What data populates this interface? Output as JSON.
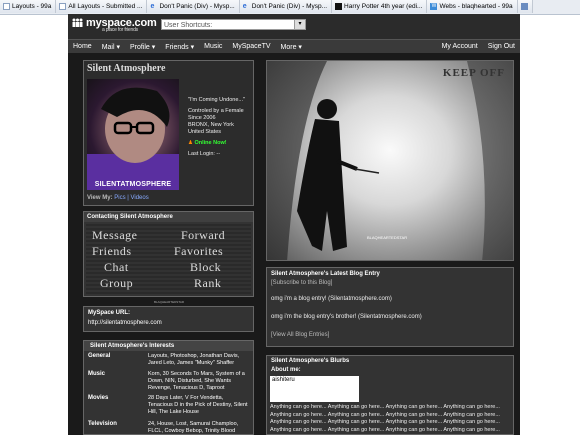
{
  "browser_tabs": [
    {
      "label": "Layouts - 99a",
      "icon": "page-icon"
    },
    {
      "label": "All Layouts - Submitted ...",
      "icon": "page-icon"
    },
    {
      "label": "Don't Panic (Div) - Mysp...",
      "icon": "ie-icon"
    },
    {
      "label": "Don't Panic (Div) - Mysp...",
      "icon": "ie-icon"
    },
    {
      "label": "Harry Potter 4th year (edi...",
      "icon": "hp-icon"
    },
    {
      "label": "Webs - blaqhearted - 99a",
      "icon": "webs-icon"
    }
  ],
  "header": {
    "logo": "myspace.com",
    "tagline": "a place for friends",
    "shortcuts_label": "User Shortcuts:"
  },
  "nav": {
    "left": [
      "Home",
      "Mail ▾",
      "Profile ▾",
      "Friends ▾",
      "Music",
      "MySpaceTV",
      "More ▾"
    ],
    "right": [
      "My Account",
      "Sign Out"
    ]
  },
  "profile": {
    "name": "Silent Atmosphere",
    "photo_caption": "SILENTATMOSPHERE",
    "quote": "\"I'm Coming Undone...\"",
    "controlled": "Controled by a Female",
    "since": "Since 2006",
    "location_city": "BRONX, New York",
    "location_country": "United States",
    "online": "Online Now!",
    "last_login": "Last Login: --",
    "view_my_prefix": "View My:",
    "view_my_links": "Pics | Videos"
  },
  "contacting": {
    "title": "Contacting Silent Atmosphere",
    "buttons": [
      "Message",
      "Forward",
      "Friends",
      "Favorites",
      "Chat",
      "Block",
      "Group",
      "Rank"
    ],
    "signature": "BLAQHEARTEDSTAR"
  },
  "myspace_url": {
    "label": "MySpace URL:",
    "value": "http://silentatmosphere.com"
  },
  "interests": {
    "title": "Silent Atmosphere's Interests",
    "rows": [
      {
        "key": "General",
        "value": "Layouts, Photoshop, Jonathan Davis, Jared Leto, James \"Munky\" Shaffer"
      },
      {
        "key": "Music",
        "value": "Korn, 30 Seconds To Mars, System of a Down, NIN, Disturbed, She Wants Revenge, Tenacious D, Taproot"
      },
      {
        "key": "Movies",
        "value": "28 Days Later, V For Vendetta, Tenacious D in the Pick of Destiny, Silent Hill, The Lake House"
      },
      {
        "key": "Television",
        "value": "24, House, Lost, Samurai Champloo, FLCL, Cowboy Bebop, Trinity Blood"
      }
    ]
  },
  "main_image": {
    "sign": "KEEP OFF",
    "signature": "BLAQHEARTEDSTAR"
  },
  "blog": {
    "title": "Silent Atmosphere's Latest Blog Entry",
    "subscribe": "[Subscribe to this Blog]",
    "entry1": "omg i'm a blog entry! (Silentatmosphere.com)",
    "entry2": "omg i'm the blog entry's brother! (Silentatmosphere.com)",
    "view_all": "[View All Blog Entries]"
  },
  "blurbs": {
    "title": "Silent Atmosphere's Blurbs",
    "about_label": "About me:",
    "about_value": "aishiteru",
    "text": "Anything can go here... Anything can go here... Anything can go here... Anything can go here... Anything can go here... Anything can go here... Anything can go here... Anything can go here... Anything can go here... Anything can go here... Anything can go here... Anything can go here... Anything can go here... Anything can go here... Anything can go here... Anything can go here..."
  },
  "colors": {
    "page_bg": "#1a1a1a",
    "box_bg": "#333333",
    "online": "#33ff33"
  }
}
